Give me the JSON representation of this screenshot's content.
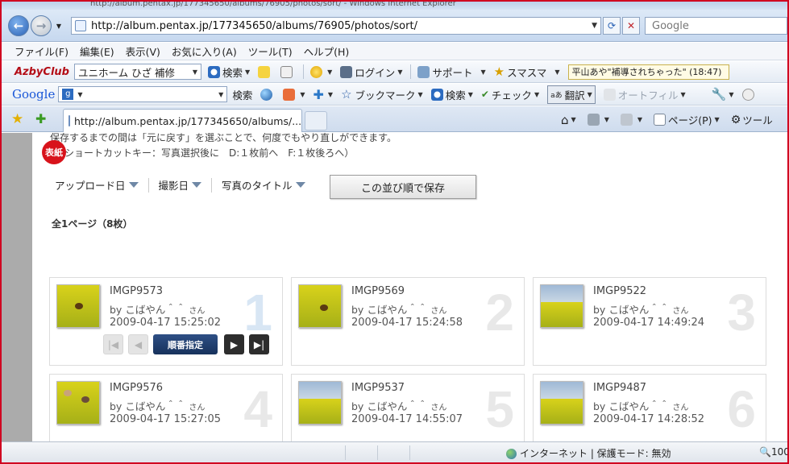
{
  "browser": {
    "title_fragment": "http://album.pentax.jp/177345650/albums/76905/photos/sort/ - Windows Internet Explorer",
    "url": "http://album.pentax.jp/177345650/albums/76905/photos/sort/",
    "search_placeholder": "Google",
    "menu": [
      "ファイル(F)",
      "編集(E)",
      "表示(V)",
      "お気に入り(A)",
      "ツール(T)",
      "ヘルプ(H)"
    ],
    "toolbar1": {
      "logo": "AzbyClub",
      "select_value": "ユニホーム ひざ 補修",
      "search": "検索",
      "login": "ログイン",
      "support": "サポート",
      "sumasuma": "スマスマ",
      "ticker": "平山あや\"補導されちゃった\" (18:47)"
    },
    "toolbar2": {
      "logo": "Google",
      "search": "検索",
      "bookmark": "ブックマーク",
      "search2": "検索",
      "check": "チェック",
      "translate": "翻訳",
      "autofill": "オートフィル"
    },
    "tab_label": "http://album.pentax.jp/177345650/albums/...",
    "command_page": "ページ(P)",
    "command_tools": "ツール"
  },
  "page": {
    "note_line1": "保存するまでの間は「元に戻す」を選ぶことで、何度でもやり直しができます。",
    "note_line2": "（ショートカットキー：写真選択後に　D:１枚前へ　F:１枚後ろへ）",
    "sort_options": [
      "アップロード日",
      "撮影日",
      "写真のタイトル"
    ],
    "save_button": "この並び順で保存",
    "page_count": "全1ページ（8枚）",
    "cover_badge": "表紙",
    "order_button": "順番指定",
    "by_prefix": "by",
    "user": "こばやん＾＾",
    "san": "さん"
  },
  "photos": [
    {
      "name": "IMGP9573",
      "date": "2009-04-17 15:25:02",
      "num": "1"
    },
    {
      "name": "IMGP9569",
      "date": "2009-04-17 15:24:58",
      "num": "2"
    },
    {
      "name": "IMGP9522",
      "date": "2009-04-17 14:49:24",
      "num": "3"
    },
    {
      "name": "IMGP9576",
      "date": "2009-04-17 15:27:05",
      "num": "4"
    },
    {
      "name": "IMGP9537",
      "date": "2009-04-17 14:55:07",
      "num": "5"
    },
    {
      "name": "IMGP9487",
      "date": "2009-04-17 14:28:52",
      "num": "6"
    }
  ],
  "status": {
    "zone": "インターネット | 保護モード: 無効",
    "zoom": "100"
  },
  "colors": {
    "accent": "#d8131b",
    "brand_azby": "#b40d16",
    "order_button": "#17325c"
  }
}
